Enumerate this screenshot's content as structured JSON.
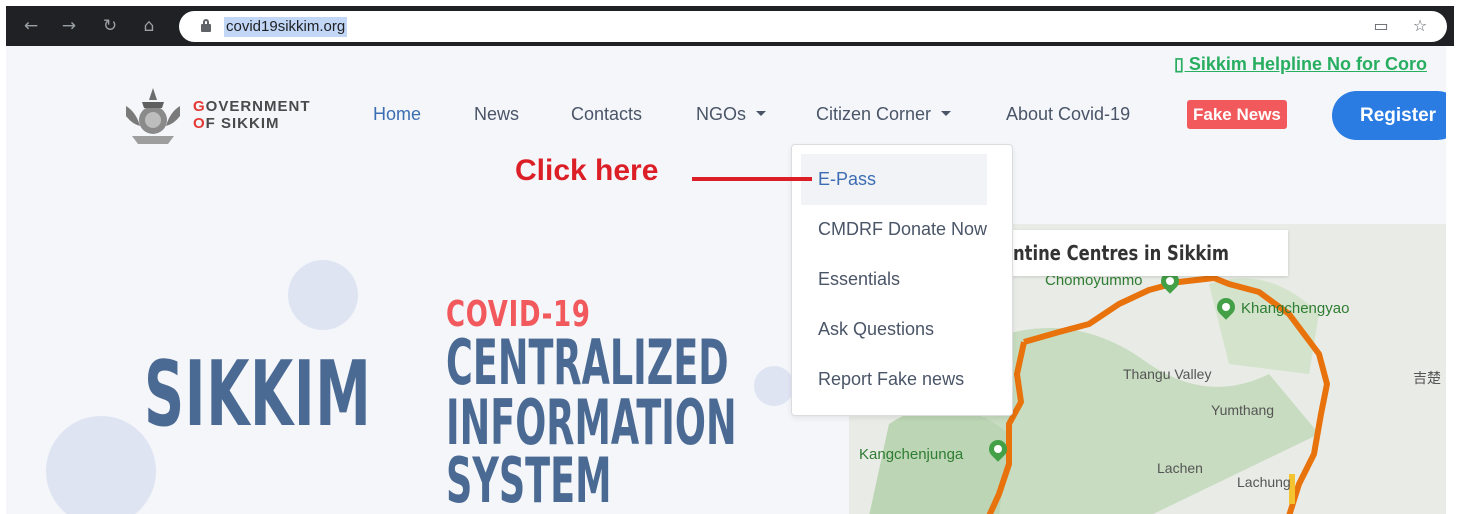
{
  "browser": {
    "url": "covid19sikkim.org",
    "icons": [
      "back-icon",
      "forward-icon",
      "reload-icon",
      "home-icon",
      "lock-icon",
      "cast-icon",
      "star-icon"
    ]
  },
  "helpline": "Sikkim Helpline No for Coro",
  "logo": {
    "line1_accent": "G",
    "line1_rest": "OVERNMENT",
    "line2_accent": "O",
    "line2_rest": "F SIKKIM"
  },
  "nav": {
    "home": "Home",
    "news": "News",
    "contacts": "Contacts",
    "ngos": "NGOs",
    "citizen_corner": "Citizen Corner",
    "about": "About Covid-19",
    "fake_news": "Fake News",
    "register": "Register"
  },
  "dropdown": {
    "items": [
      "E-Pass",
      "CMDRF Donate Now",
      "Essentials",
      "Ask Questions",
      "Report Fake news"
    ]
  },
  "annotation": "Click here",
  "hero": {
    "covid": "COVID-19",
    "sikkim": "SIKKIM",
    "line1": "CENTRALIZED",
    "line2": "INFORMATION",
    "line3": "SYSTEM"
  },
  "map": {
    "title": "ntine Centres in Sikkim",
    "labels": [
      "Chomoyummo",
      "Khangchengyao",
      "Thangu Valley",
      "Yumthang",
      "Kangchenjunga",
      "Lachen",
      "Lachung",
      "吉楚"
    ]
  },
  "colors": {
    "accent_blue": "#2a7ce3",
    "fake_news_red": "#f1595c",
    "annotation_red": "#dc1f26",
    "helpline_green": "#27ae60",
    "hero_blue": "#4b6a93"
  }
}
